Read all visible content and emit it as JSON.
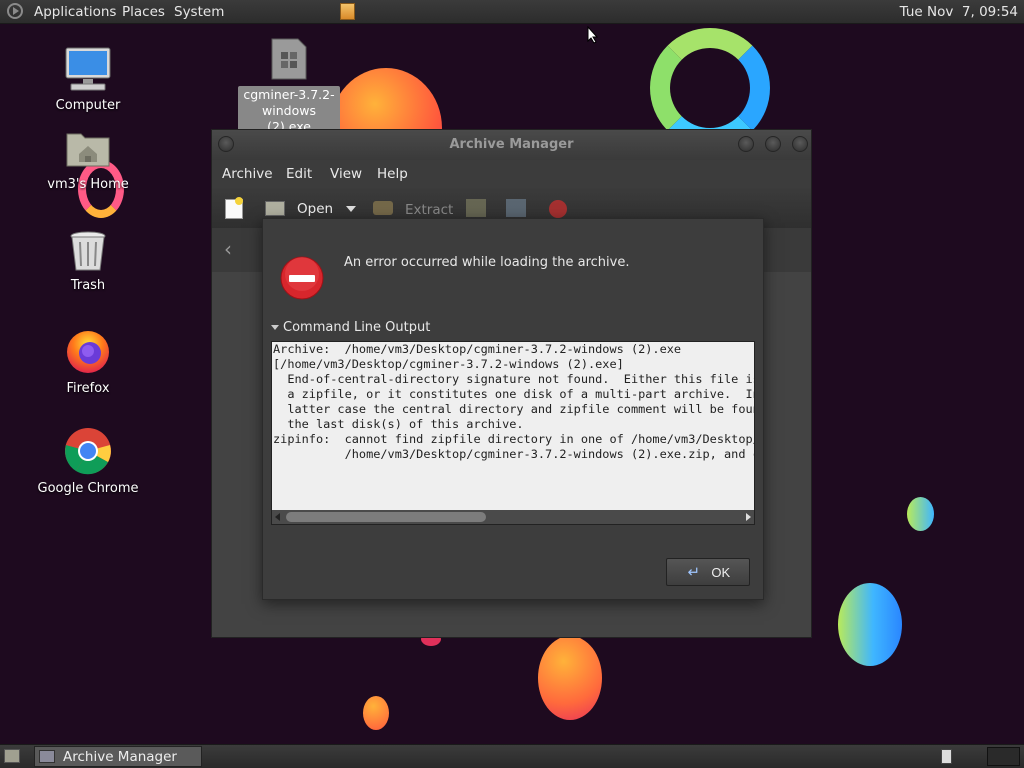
{
  "top_panel": {
    "menus": [
      "Applications",
      "Places",
      "System"
    ],
    "clock": "Tue Nov  7, 09:54"
  },
  "desktop": {
    "icons": [
      {
        "label": "Computer",
        "icon": "computer-icon"
      },
      {
        "label": "vm3's Home",
        "icon": "home-folder-icon"
      },
      {
        "label": "Trash",
        "icon": "trash-icon"
      },
      {
        "label": "Firefox",
        "icon": "firefox-icon"
      },
      {
        "label": "Google Chrome",
        "icon": "chrome-icon"
      }
    ],
    "file_icon": {
      "label_line1": "cgminer-3.7.2-",
      "label_line2": "windows (2).exe",
      "icon": "exe-file-icon"
    }
  },
  "archive_window": {
    "title": "Archive Manager",
    "menu": [
      "Archive",
      "Edit",
      "View",
      "Help"
    ],
    "toolbar": {
      "open_label": "Open",
      "extract_label": "Extract"
    }
  },
  "error_dialog": {
    "message": "An error occurred while loading the archive.",
    "expander_label": "Command Line Output",
    "output": "Archive:  /home/vm3/Desktop/cgminer-3.7.2-windows (2).exe\n[/home/vm3/Desktop/cgminer-3.7.2-windows (2).exe]\n  End-of-central-directory signature not found.  Either this file is not\n  a zipfile, or it constitutes one disk of a multi-part archive.  In the\n  latter case the central directory and zipfile comment will be found on\n  the last disk(s) of this archive.\nzipinfo:  cannot find zipfile directory in one of /home/vm3/Desktop/cgminer-3.7.2-windows (2).exe or\n          /home/vm3/Desktop/cgminer-3.7.2-windows (2).exe.zip, and cannot find",
    "ok_label": "OK"
  },
  "taskbar": {
    "tasks": [
      {
        "label": "Archive Manager",
        "icon": "archive-manager-icon"
      }
    ]
  },
  "colors": {
    "desktop_bg": "#1e0a1f",
    "error_red": "#d8262c",
    "panel": "#333333"
  }
}
